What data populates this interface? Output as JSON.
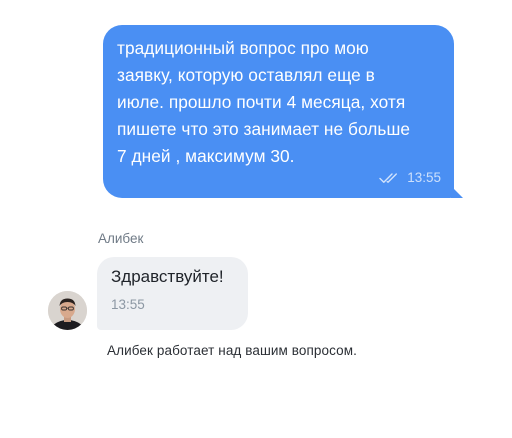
{
  "messages": {
    "outgoing": {
      "text": "традиционный вопрос про мою\nзаявку, которую оставлял еще в\nиюле. прошло почти 4 месяца, хотя\nпишете что это занимает не больше\n7 дней , максимум 30.",
      "time": "13:55",
      "status_icon": "double-check-icon",
      "color": "#4a8ff3"
    },
    "incoming": {
      "sender": "Алибек",
      "text": "Здравствуйте!",
      "time": "13:55",
      "color": "#eef0f3"
    }
  },
  "status": {
    "text": "Алибек работает над вашим вопросом."
  }
}
